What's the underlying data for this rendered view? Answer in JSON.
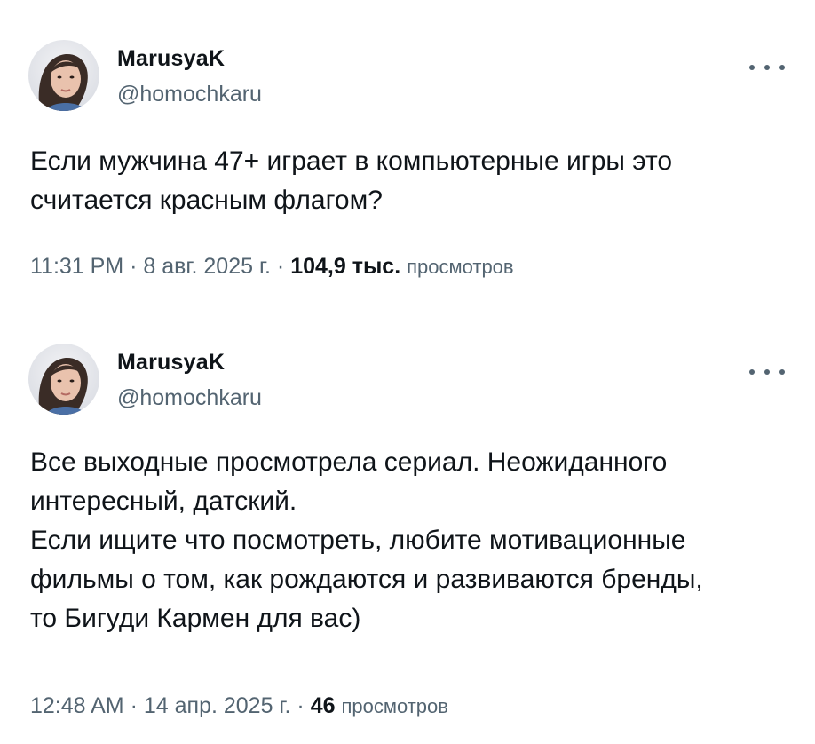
{
  "tweets": [
    {
      "author": {
        "display_name": "MarusyaK",
        "handle": "@homochkaru",
        "avatar_icon": "avatar-photo"
      },
      "text": "Если мужчина 47+ играет в компьютерные игры это\nсчитается красным флагом?",
      "time": "11:31 PM",
      "date": "8 авг. 2025 г.",
      "views_count": "104,9 тыс.",
      "views_label": "просмотров",
      "more_icon": "more-horizontal-icon"
    },
    {
      "author": {
        "display_name": "MarusyaK",
        "handle": "@homochkaru",
        "avatar_icon": "avatar-photo"
      },
      "text": "Все выходные просмотрела сериал. Неожиданного\nинтересный, датский.\nЕсли ищите что посмотреть, любите мотивационные\nфильмы о том, как рождаются и развиваются бренды,\nто Бигуди Кармен для вас)",
      "time": "12:48 AM",
      "date": "14 апр. 2025 г.",
      "views_count": "46",
      "views_label": "просмотров",
      "more_icon": "more-horizontal-icon"
    }
  ],
  "separator": "·",
  "colors": {
    "text": "#0f1419",
    "secondary": "#536471",
    "background": "#ffffff"
  }
}
